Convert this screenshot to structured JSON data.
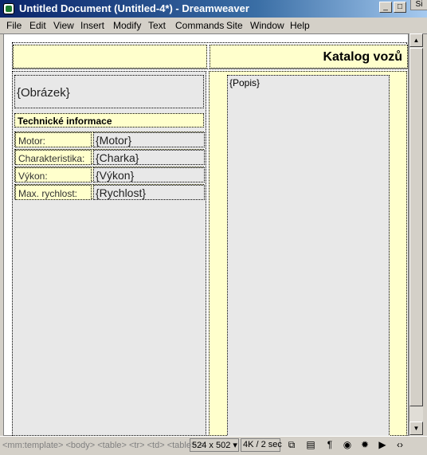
{
  "window": {
    "title": "Untitled Document (Untitled-4*) - Dreamweaver",
    "minimize_icon": "minimize-icon",
    "maximize_icon": "maximize-icon",
    "close_icon": "close-icon",
    "peek_label": "Si"
  },
  "menu": {
    "items": [
      {
        "label": "File"
      },
      {
        "label": "Edit"
      },
      {
        "label": "View"
      },
      {
        "label": "Insert"
      },
      {
        "label": "Modify"
      },
      {
        "label": "Text"
      },
      {
        "label": "Commands"
      },
      {
        "label": "Site"
      },
      {
        "label": "Window"
      },
      {
        "label": "Help"
      }
    ]
  },
  "document": {
    "header_title": "Katalog vozů",
    "image_placeholder": "{Obrázek}",
    "tech_heading": "Technické informace",
    "specs": [
      {
        "label": "Motor:",
        "value": "{Motor}"
      },
      {
        "label": "Charakteristika:",
        "value": "{Charka}"
      },
      {
        "label": "Výkon:",
        "value": "{Výkon}"
      },
      {
        "label": "Max. rychlost:",
        "value": "{Rychlost}"
      }
    ],
    "description_placeholder": "{Popis}"
  },
  "status": {
    "tag_path": "<mm:template> <body> <table> <tr> <td> <table> <",
    "window_size": "524 x 502 ▾",
    "download_time": "4K / 2 sec",
    "icons": [
      "site-icon",
      "assets-icon",
      "html-styles-icon",
      "css-styles-icon",
      "behaviors-icon",
      "timeline-icon",
      "html-source-icon"
    ]
  },
  "colors": {
    "cell_yellow": "#ffffcc",
    "cell_gray": "#e8e8e8",
    "titlebar": "#0a246a"
  }
}
